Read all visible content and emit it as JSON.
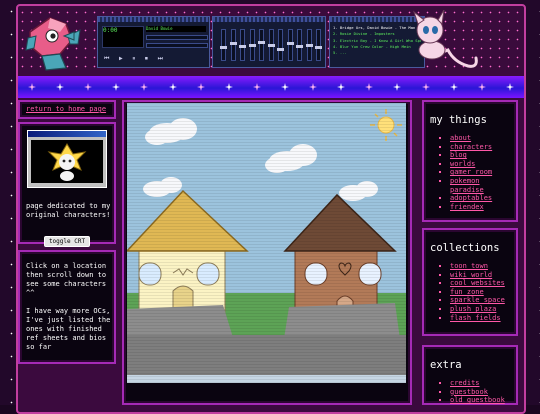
{
  "header": {
    "winamp_main": {
      "track_marquee": "David Bowie",
      "time": "0:00",
      "buttons": [
        "prev-icon",
        "play-icon",
        "pause-icon",
        "stop-icon",
        "next-icon",
        "eject-icon"
      ],
      "icons": {
        "prev": "⏮",
        "play": "▶",
        "pause": "⏸",
        "stop": "⏹",
        "next": "⏭"
      }
    },
    "winamp_eq": {
      "levels": [
        0.4,
        0.55,
        0.45,
        0.5,
        0.6,
        0.5,
        0.35,
        0.55,
        0.45,
        0.5,
        0.4
      ]
    },
    "winamp_playlist": {
      "tracks": [
        "1. Bridge Urs, David Bowie - The Man Who Sold",
        "2. Rosie Divine - Imposters",
        "3. Electric Boy - I Know A Girl Who Spoke",
        "4. Blur Yun Crew Color - High Mein",
        "5. ..."
      ]
    }
  },
  "left": {
    "return_link": "return to home page",
    "intro_text": "page dedicated to my original characters!",
    "toggle_crt": "toggle CRT",
    "info_text_1": "Click on a location then scroll down to see some characters ^^",
    "info_text_2": "I have way more OCs, I've just listed the ones with finished ref sheets and bios so far"
  },
  "right": {
    "my_things": {
      "title": "my things",
      "items": [
        "about",
        "characters",
        "blog",
        "worlds",
        "gamer room",
        "pokemon paradise",
        "adoptables",
        "friendex"
      ]
    },
    "collections": {
      "title": "collections",
      "items": [
        "toon town",
        "wiki world",
        "cool websites",
        "fun zone",
        "sparkle space",
        "plush plaza",
        "flash fields"
      ]
    },
    "extra": {
      "title": "extra",
      "items": [
        "credits",
        "guestbook",
        "old guestbook"
      ]
    }
  },
  "colors": {
    "link_pink": "#ff58a8",
    "panel_border": "#a52ab6",
    "nav_blue": "#2b16d6"
  }
}
